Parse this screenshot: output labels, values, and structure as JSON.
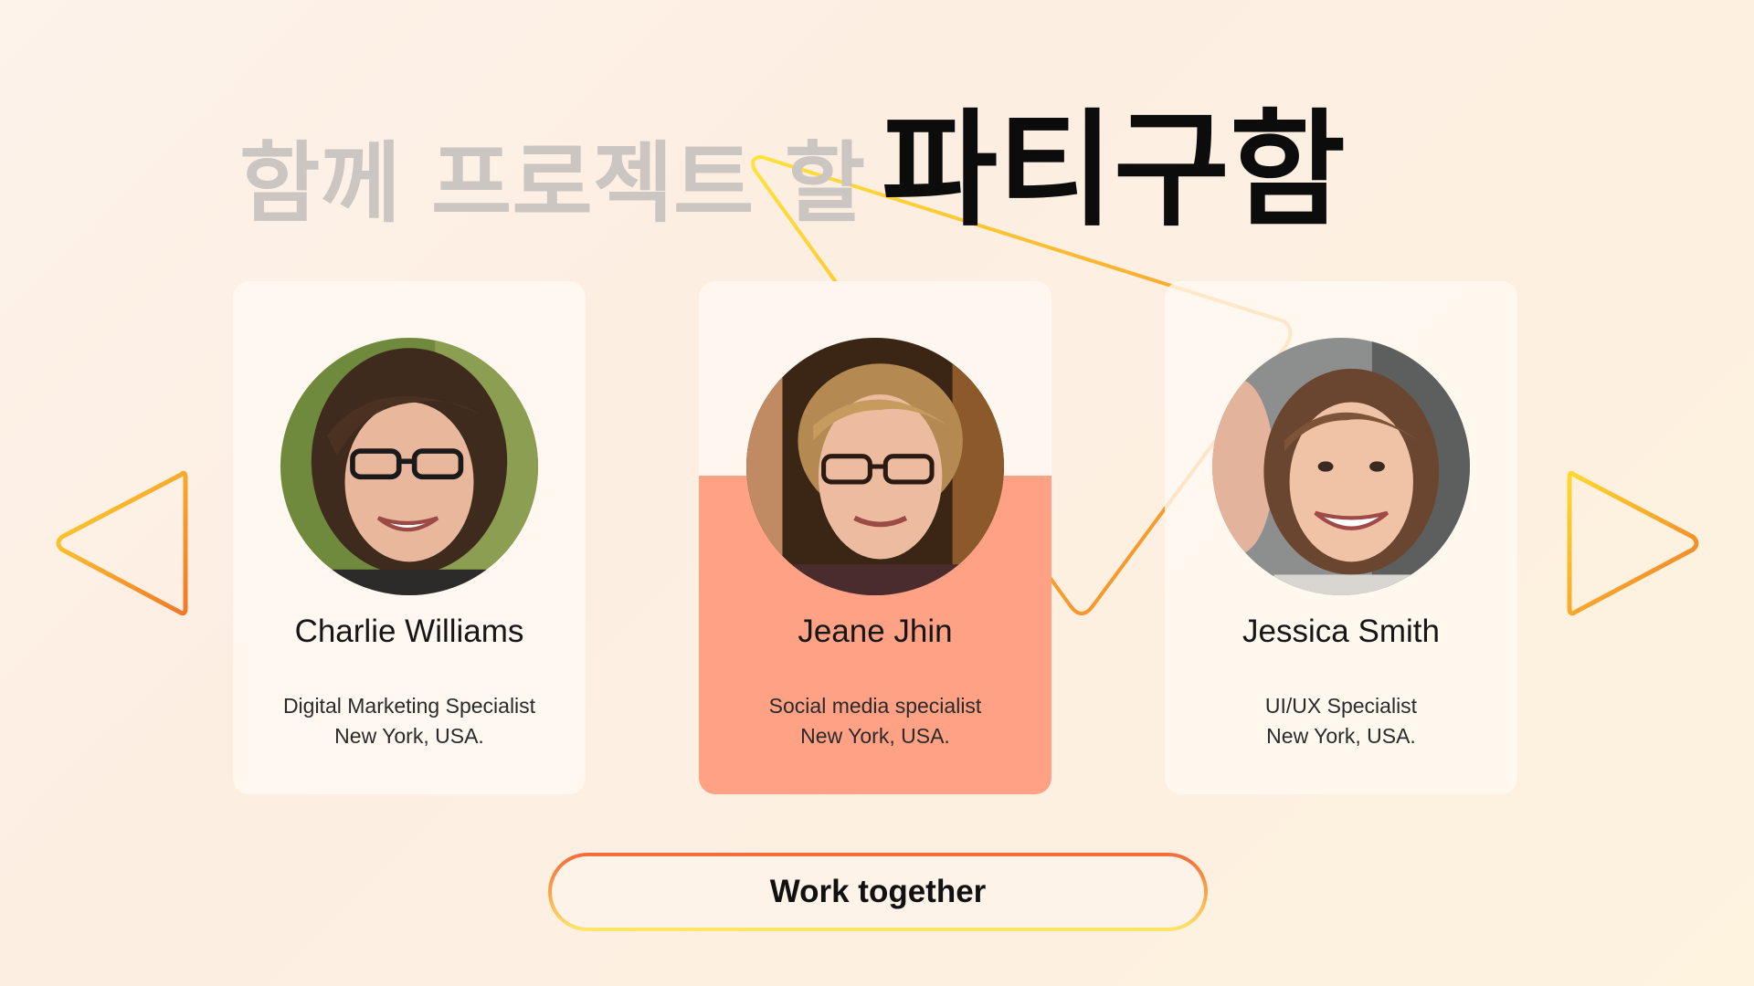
{
  "title": {
    "light": "함께 프로젝트 할",
    "bold": "파티구함"
  },
  "cards": [
    {
      "name": "Charlie Williams",
      "role": "Digital Marketing Specialist",
      "location": "New York, USA."
    },
    {
      "name": "Jeane Jhin",
      "role": "Social media specialist",
      "location": "New York, USA."
    },
    {
      "name": "Jessica Smith",
      "role": "UI/UX Specialist",
      "location": "New York, USA."
    }
  ],
  "icons": {
    "prev": "chevron-left-triangle-icon",
    "next": "chevron-right-triangle-icon"
  },
  "cta": {
    "label": "Work together"
  },
  "colors": {
    "accent_orange": "#f07a2c",
    "accent_yellow": "#ffd02a",
    "active_card": "#fea185",
    "title_light": "#cbc6c2",
    "title_dark": "#0c0c0c"
  }
}
